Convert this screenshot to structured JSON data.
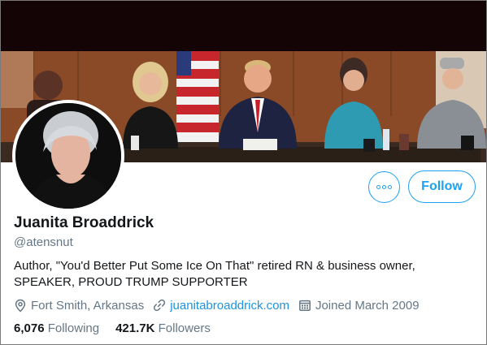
{
  "profile": {
    "name": "Juanita Broaddrick",
    "handle": "@atensnut",
    "bio_line1": "Author, \"You'd Better Put Some Ice On That\" retired RN & business owner,",
    "bio_line2": "SPEAKER, PROUD TRUMP SUPPORTER",
    "location": "Fort Smith, Arkansas",
    "website": "juanitabroaddrick.com",
    "joined": "Joined March 2009"
  },
  "actions": {
    "follow_label": "Follow",
    "more_icon": "more-dots-icon"
  },
  "stats": {
    "following_count": "6,076",
    "following_label": "Following",
    "followers_count": "421.7K",
    "followers_label": "Followers"
  },
  "icons": {
    "location": "location-pin-icon",
    "link": "link-icon",
    "calendar": "calendar-icon"
  },
  "colors": {
    "accent": "#1da1f2",
    "link": "#1b95e0",
    "secondary_text": "#657786",
    "primary_text": "#14171a"
  }
}
